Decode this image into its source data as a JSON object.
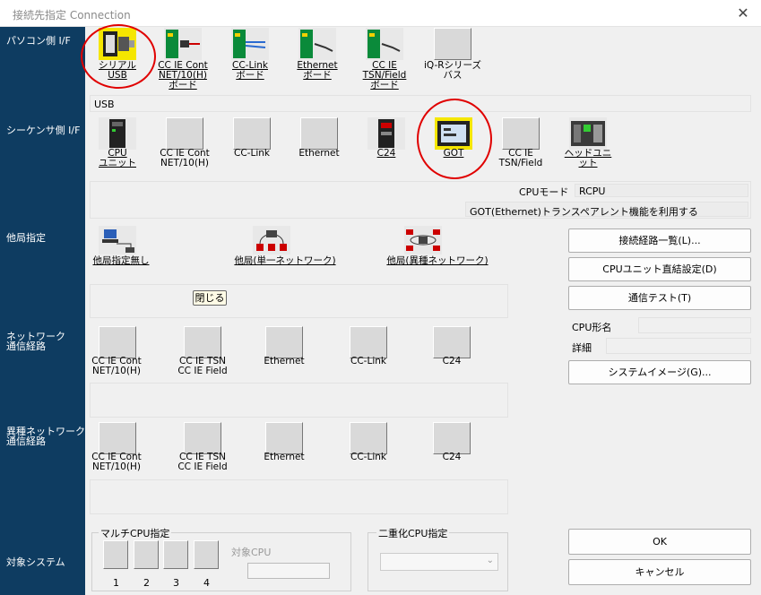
{
  "window": {
    "title": "接続先指定 Connection"
  },
  "left_labels": {
    "pc_if": "パソコン側 I/F",
    "seq_if": "シーケンサ側 I/F",
    "other": "他局指定",
    "network1": "ネットワーク",
    "network2": "通信経路",
    "hetero1": "異種ネットワーク",
    "hetero2": "通信経路",
    "target": "対象システム"
  },
  "pc_if": [
    {
      "label": "シリアル\nUSB",
      "icon": "serial-usb-icon"
    },
    {
      "label": "CC IE Cont\nNET/10(H)\nボード",
      "icon": "board-icon"
    },
    {
      "label": "CC-Link\nボード",
      "icon": "board-icon"
    },
    {
      "label": "Ethernet\nボード",
      "icon": "board-icon"
    },
    {
      "label": "CC IE\nTSN/Field\nボード",
      "icon": "board-icon"
    },
    {
      "label": "iQ-Rシリーズ\nバス",
      "icon": "blank-icon"
    }
  ],
  "pc_if_selected": "USB",
  "seq_if": [
    {
      "label": "CPU\nユニット",
      "icon": "cpu-unit-icon"
    },
    {
      "label": "CC IE Cont\nNET/10(H)",
      "icon": "blank-icon"
    },
    {
      "label": "CC-Link",
      "icon": "blank-icon"
    },
    {
      "label": "Ethernet",
      "icon": "blank-icon"
    },
    {
      "label": "C24",
      "icon": "c24-icon"
    },
    {
      "label": "GOT",
      "icon": "got-icon"
    },
    {
      "label": "CC IE\nTSN/Field",
      "icon": "blank-icon"
    },
    {
      "label": "ヘッドユニット",
      "icon": "head-unit-icon"
    }
  ],
  "seq_info": {
    "cpu_mode_label": "CPUモード",
    "cpu_mode_value": "RCPU",
    "got_transparent": "GOT(Ethernet)トランスペアレント機能を利用する"
  },
  "other_station": [
    {
      "label": "他局指定無し",
      "icon": "pc-station-icon"
    },
    {
      "label": "他局(単一ネットワーク)",
      "icon": "single-network-icon"
    },
    {
      "label": "他局(異種ネットワーク)",
      "icon": "multi-network-icon"
    }
  ],
  "close_btn": "閉じる",
  "network_routes": [
    {
      "label": "CC IE Cont\nNET/10(H)"
    },
    {
      "label": "CC IE TSN\nCC IE Field"
    },
    {
      "label": "Ethernet"
    },
    {
      "label": "CC-Link"
    },
    {
      "label": "C24"
    }
  ],
  "hetero_routes": [
    {
      "label": "CC IE Cont\nNET/10(H)"
    },
    {
      "label": "CC IE TSN\nCC IE Field"
    },
    {
      "label": "Ethernet"
    },
    {
      "label": "CC-Link"
    },
    {
      "label": "C24"
    }
  ],
  "buttons": {
    "route_list": "接続経路一覧(L)...",
    "cpu_direct": "CPUユニット直結設定(D)",
    "comm_test": "通信テスト(T)",
    "system_image": "システムイメージ(G)...",
    "ok": "OK",
    "cancel": "キャンセル"
  },
  "cpu_fields": {
    "cpu_type": "CPU形名",
    "detail": "詳細"
  },
  "multi_cpu": {
    "title": "マルチCPU指定",
    "target_cpu": "対象CPU",
    "nums": [
      "1",
      "2",
      "3",
      "4"
    ]
  },
  "redundant": {
    "title": "二重化CPU指定"
  }
}
